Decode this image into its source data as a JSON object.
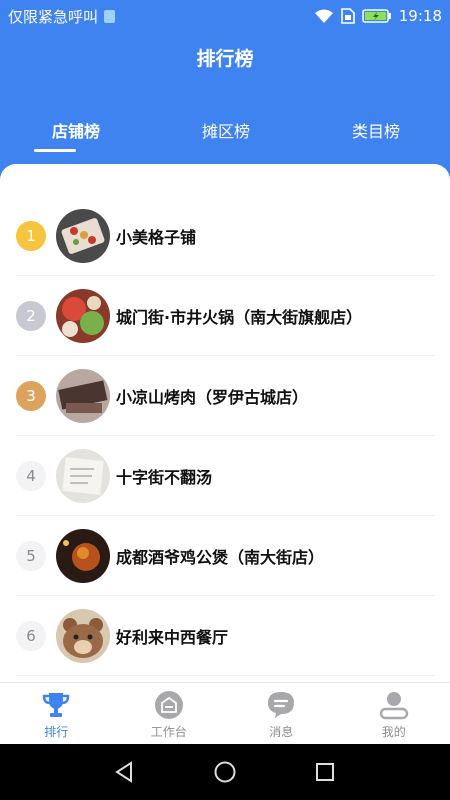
{
  "status_bar": {
    "carrier": "仅限紧急呼叫",
    "time": "19:18"
  },
  "page": {
    "title": "排行榜"
  },
  "tabs": [
    {
      "label": "店铺榜",
      "active": true
    },
    {
      "label": "摊区榜",
      "active": false
    },
    {
      "label": "类目榜",
      "active": false
    }
  ],
  "ranking": [
    {
      "rank": "1",
      "name": "小美格子铺",
      "badge_color": "#f6c43f"
    },
    {
      "rank": "2",
      "name": "城门街·市井火锅（南大街旗舰店）",
      "badge_color": "#c7c8d2"
    },
    {
      "rank": "3",
      "name": "小凉山烤肉（罗伊古城店）",
      "badge_color": "#dca35c"
    },
    {
      "rank": "4",
      "name": "十字街不翻汤",
      "badge_color": "#f3f3f5"
    },
    {
      "rank": "5",
      "name": "成都酒爷鸡公煲（南大街店）",
      "badge_color": "#f3f3f5"
    },
    {
      "rank": "6",
      "name": "好利来中西餐厅",
      "badge_color": "#f3f3f5"
    }
  ],
  "bottom_nav": [
    {
      "label": "排行",
      "icon": "trophy-icon",
      "active": true
    },
    {
      "label": "工作台",
      "icon": "workbench-icon",
      "active": false
    },
    {
      "label": "消息",
      "icon": "message-icon",
      "active": false
    },
    {
      "label": "我的",
      "icon": "profile-icon",
      "active": false
    }
  ],
  "colors": {
    "primary": "#3f83f1",
    "inactive": "#8d8d8d"
  }
}
